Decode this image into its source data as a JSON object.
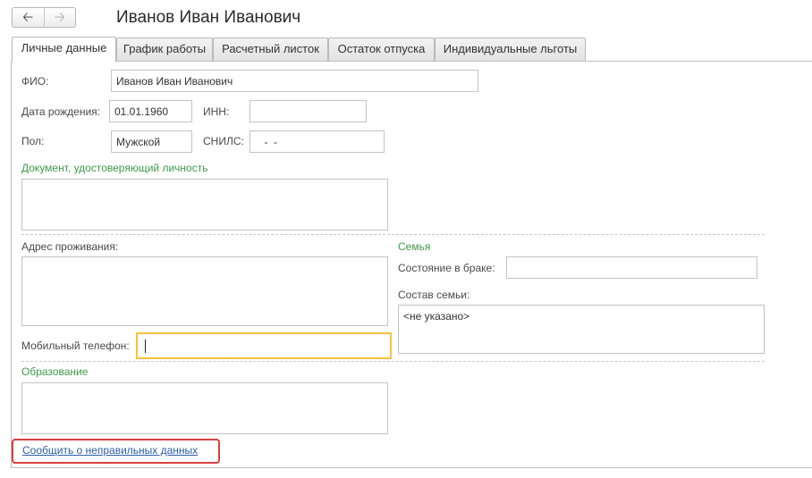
{
  "window": {
    "title": "Иванов Иван Иванович"
  },
  "nav": {
    "back_icon": "arrow-left-icon",
    "forward_icon": "arrow-right-icon"
  },
  "tabs": [
    {
      "label": "Личные данные",
      "active": true
    },
    {
      "label": "График работы",
      "active": false
    },
    {
      "label": "Расчетный листок",
      "active": false
    },
    {
      "label": "Остаток отпуска",
      "active": false
    },
    {
      "label": "Индивидуальные льготы",
      "active": false
    }
  ],
  "form": {
    "fio_label": "ФИО:",
    "fio_value": "Иванов Иван Иванович",
    "birth_label": "Дата рождения:",
    "birth_value": "01.01.1960",
    "inn_label": "ИНН:",
    "inn_value": "",
    "gender_label": "Пол:",
    "gender_value": "Мужской",
    "snils_label": "СНИЛС:",
    "snils_value": " -  -",
    "document_title": "Документ, удостоверяющий личность",
    "document_value": "",
    "address_label": "Адрес проживания:",
    "address_value": "",
    "mobile_label": "Мобильный телефон:",
    "mobile_value": "",
    "family_title": "Семья",
    "marital_label": "Состояние в браке:",
    "marital_value": "",
    "family_composition_label": "Состав семьи:",
    "family_composition_value": "<не указано>",
    "education_title": "Образование",
    "education_value": ""
  },
  "report_link": "Сообщить о неправильных данных",
  "colors": {
    "section_title": "#3d9a4a",
    "link": "#2a5ea8",
    "focus_border": "#f5c23a",
    "highlight_box": "#d94040"
  }
}
